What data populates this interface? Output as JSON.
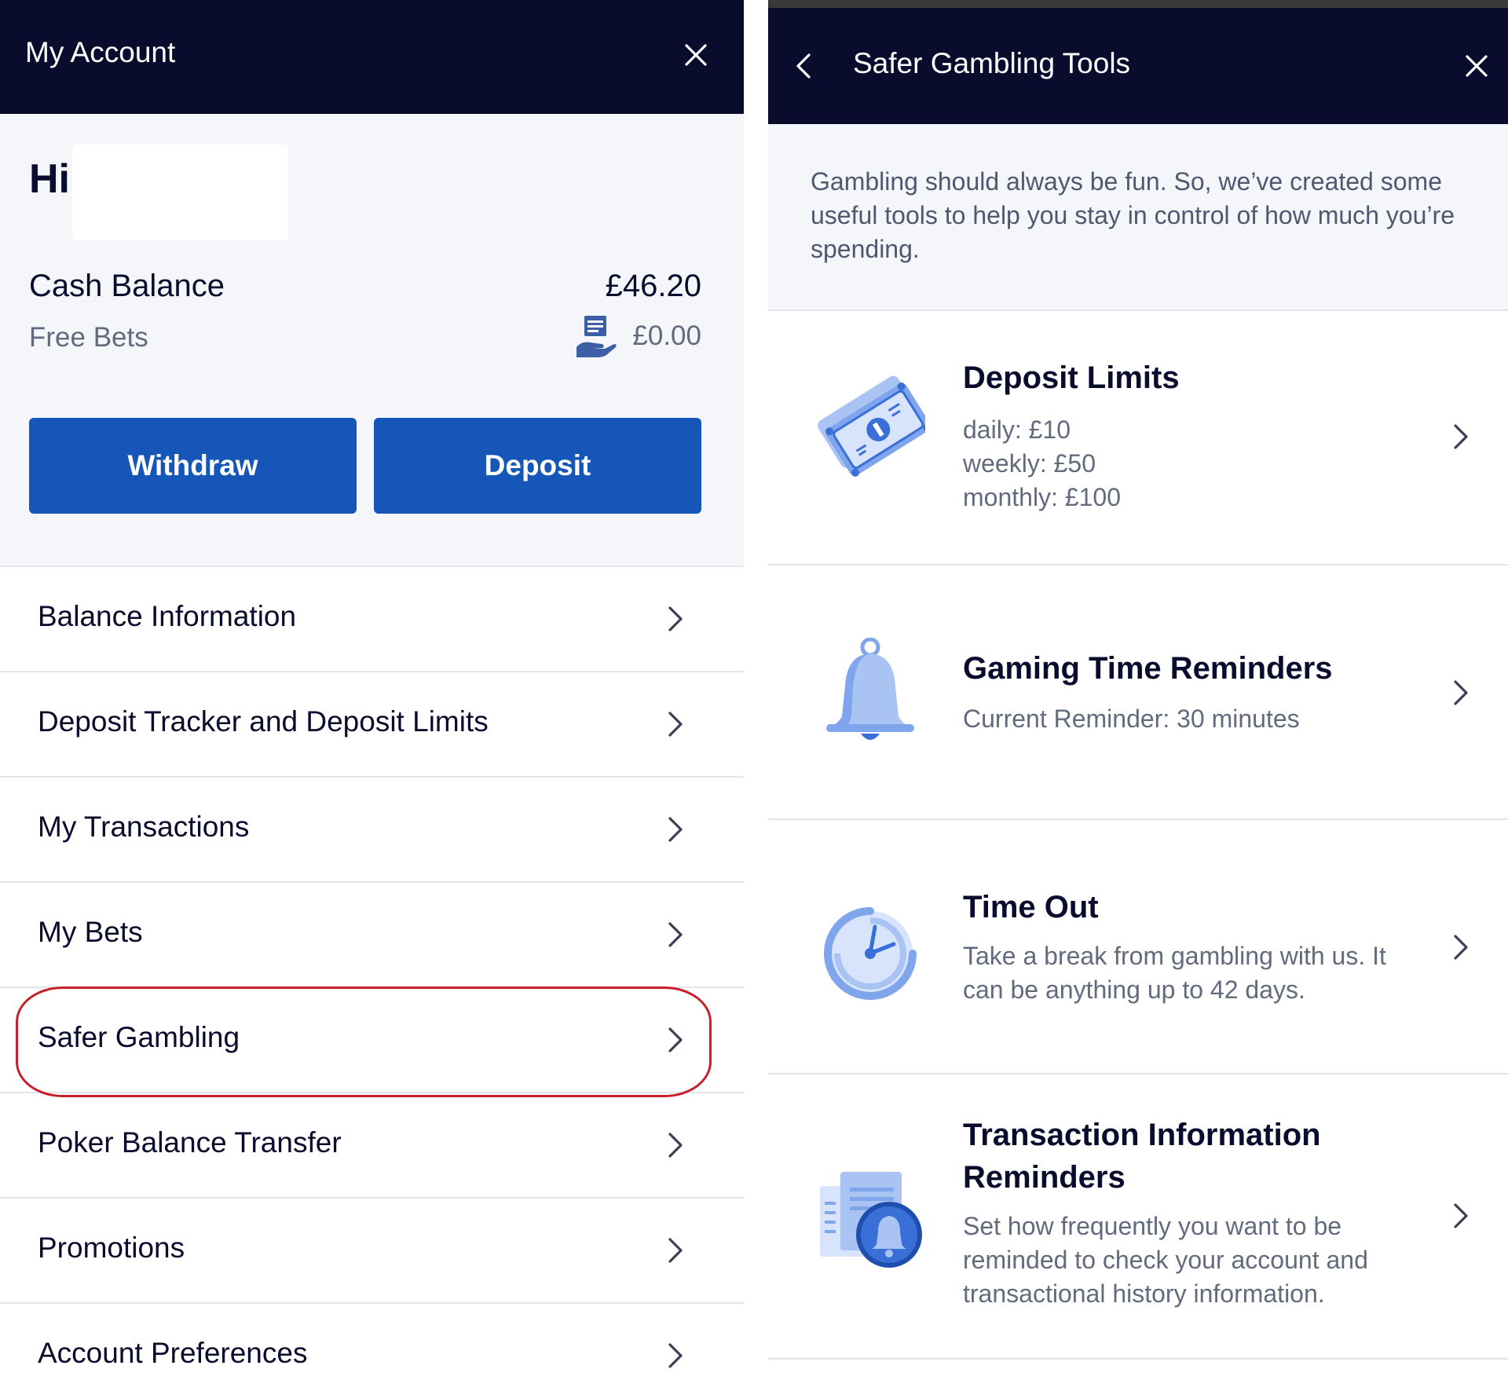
{
  "left_panel": {
    "title": "My Account",
    "greeting": "Hi",
    "balance": {
      "cash_label": "Cash Balance",
      "cash_value": "£46.20",
      "free_bets_label": "Free Bets",
      "free_bets_value": "£0.00"
    },
    "buttons": {
      "withdraw": "Withdraw",
      "deposit": "Deposit"
    },
    "menu": [
      {
        "label": "Balance Information"
      },
      {
        "label": "Deposit Tracker and Deposit Limits"
      },
      {
        "label": "My Transactions"
      },
      {
        "label": "My Bets"
      },
      {
        "label": "Safer Gambling",
        "highlighted": true
      },
      {
        "label": "Poker Balance Transfer"
      },
      {
        "label": "Promotions"
      },
      {
        "label": "Account Preferences"
      }
    ]
  },
  "right_panel": {
    "title": "Safer Gambling Tools",
    "intro": "Gambling should always be fun. So, we’ve created some useful tools to help you stay in control of how much you’re spending.",
    "tools": [
      {
        "title": "Deposit Limits",
        "lines": [
          "daily:  £10",
          "weekly:  £50",
          "monthly:  £100"
        ],
        "icon": "money-notes-icon"
      },
      {
        "title": "Gaming Time Reminders",
        "lines": [
          "Current Reminder: 30 minutes"
        ],
        "icon": "bell-icon"
      },
      {
        "title": "Time Out",
        "lines": [
          "Take a break from gambling with us. It can be anything up to 42 days."
        ],
        "icon": "timer-icon"
      },
      {
        "title": "Transaction Information Reminders",
        "lines": [
          "Set how frequently you want to be reminded to check your account and transactional history information."
        ],
        "icon": "document-bell-icon"
      }
    ]
  },
  "colors": {
    "navbar": "#0a0c2e",
    "button": "#1656b8",
    "highlight": "#c8202a",
    "icon_light": "#a9c3f3",
    "icon_dark": "#3b6fd8"
  }
}
